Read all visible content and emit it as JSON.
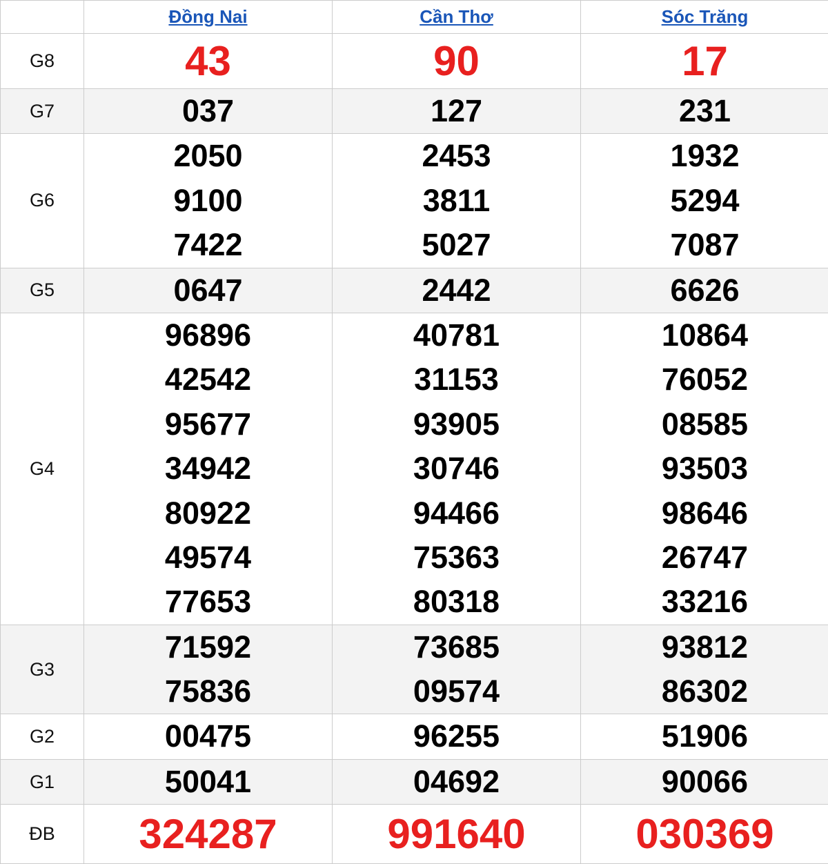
{
  "provinces": [
    "Đồng Nai",
    "Cần Thơ",
    "Sóc Trăng"
  ],
  "colors": {
    "highlight": "#e8201f",
    "link": "#1a56b8",
    "stripe": "#f3f3f3"
  },
  "prizes": [
    {
      "label": "G8",
      "results": [
        [
          "43"
        ],
        [
          "90"
        ],
        [
          "17"
        ]
      ]
    },
    {
      "label": "G7",
      "results": [
        [
          "037"
        ],
        [
          "127"
        ],
        [
          "231"
        ]
      ]
    },
    {
      "label": "G6",
      "results": [
        [
          "2050",
          "9100",
          "7422"
        ],
        [
          "2453",
          "3811",
          "5027"
        ],
        [
          "1932",
          "5294",
          "7087"
        ]
      ]
    },
    {
      "label": "G5",
      "results": [
        [
          "0647"
        ],
        [
          "2442"
        ],
        [
          "6626"
        ]
      ]
    },
    {
      "label": "G4",
      "results": [
        [
          "96896",
          "42542",
          "95677",
          "34942",
          "80922",
          "49574",
          "77653"
        ],
        [
          "40781",
          "31153",
          "93905",
          "30746",
          "94466",
          "75363",
          "80318"
        ],
        [
          "10864",
          "76052",
          "08585",
          "93503",
          "98646",
          "26747",
          "33216"
        ]
      ]
    },
    {
      "label": "G3",
      "results": [
        [
          "71592",
          "75836"
        ],
        [
          "73685",
          "09574"
        ],
        [
          "93812",
          "86302"
        ]
      ]
    },
    {
      "label": "G2",
      "results": [
        [
          "00475"
        ],
        [
          "96255"
        ],
        [
          "51906"
        ]
      ]
    },
    {
      "label": "G1",
      "results": [
        [
          "50041"
        ],
        [
          "04692"
        ],
        [
          "90066"
        ]
      ]
    },
    {
      "label": "ĐB",
      "results": [
        [
          "324287"
        ],
        [
          "991640"
        ],
        [
          "030369"
        ]
      ]
    }
  ]
}
